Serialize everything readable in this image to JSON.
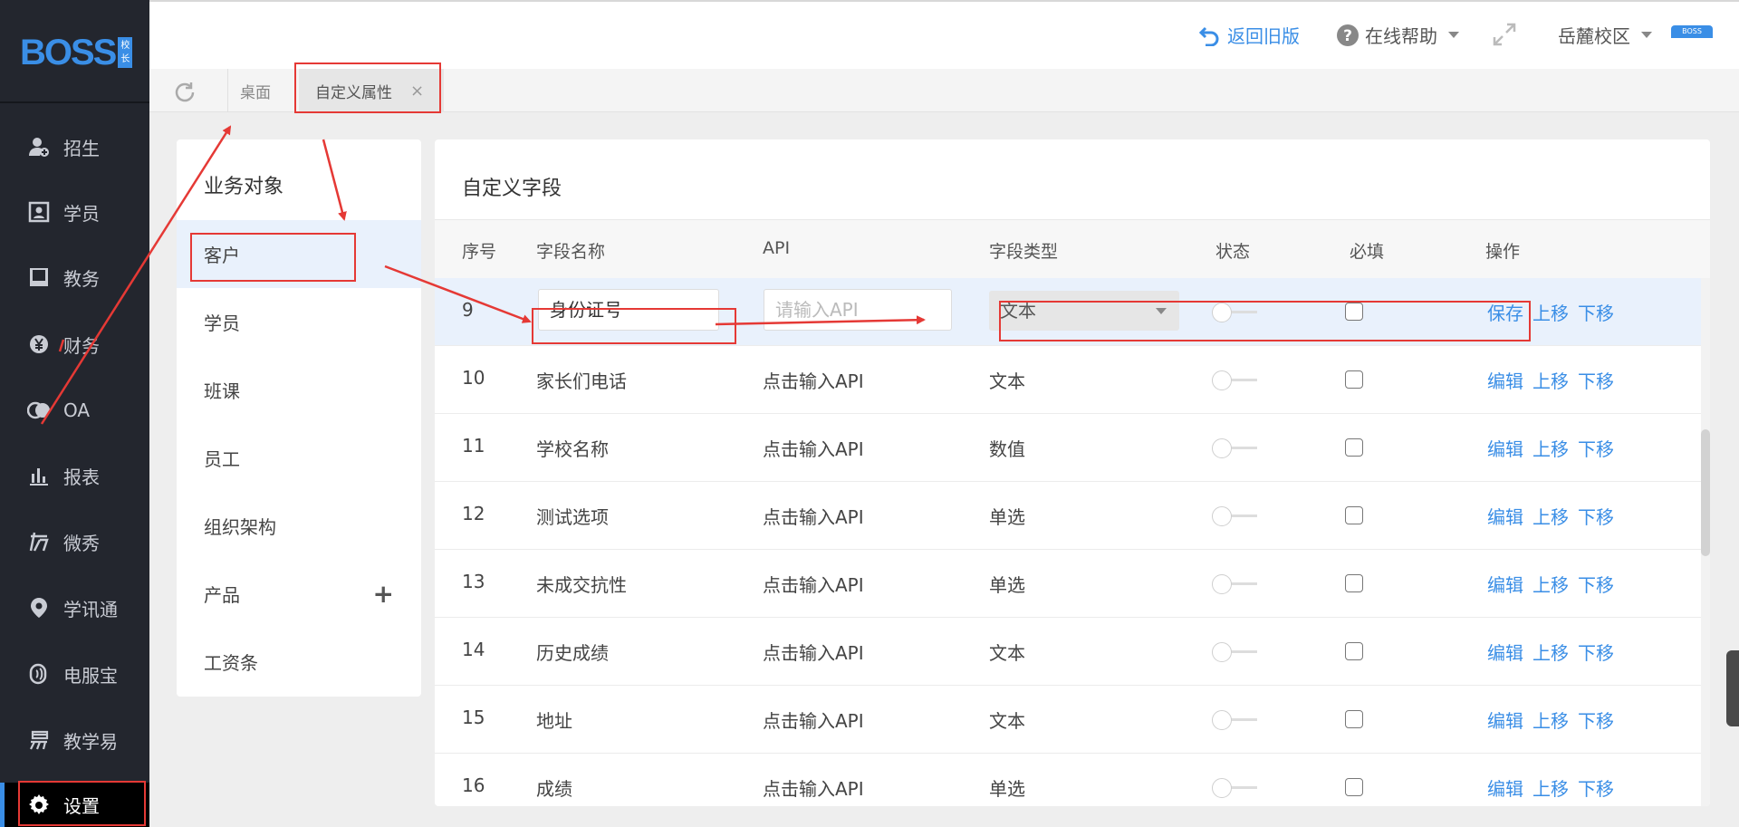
{
  "app": {
    "logo_text": "BOSS",
    "logo_badge": "校长"
  },
  "sidebar": {
    "items": [
      {
        "label": "招生",
        "icon": "user-add-icon"
      },
      {
        "label": "学员",
        "icon": "id-card-icon"
      },
      {
        "label": "教务",
        "icon": "book-icon"
      },
      {
        "label": "财务",
        "icon": "yen-coin-icon"
      },
      {
        "label": "OA",
        "icon": "oa-circles-icon"
      },
      {
        "label": "报表",
        "icon": "bar-chart-icon"
      },
      {
        "label": "微秀",
        "icon": "weixiu-icon"
      },
      {
        "label": "学讯通",
        "icon": "location-pin-icon"
      },
      {
        "label": "电服宝",
        "icon": "phone-signal-icon"
      },
      {
        "label": "教学易",
        "icon": "edu-logo-icon"
      },
      {
        "label": "设置",
        "icon": "gear-icon",
        "active": true
      }
    ]
  },
  "header": {
    "back_label": "返回旧版",
    "help_label": "在线帮助",
    "campus_label": "岳麓校区",
    "avatar_label": "BOSS"
  },
  "tabs": {
    "desk_label": "桌面",
    "custom_label": "自定义属性",
    "close_glyph": "×"
  },
  "objects": {
    "title": "业务对象",
    "items": [
      "客户",
      "学员",
      "班课",
      "员工",
      "组织架构",
      "产品",
      "工资条"
    ],
    "active_index": 0,
    "plus_glyph": "+"
  },
  "fields": {
    "title": "自定义字段",
    "columns": [
      "序号",
      "字段名称",
      "API",
      "字段类型",
      "状态",
      "必填",
      "操作"
    ],
    "editing_row": {
      "no": "9",
      "name_value": "身份证号",
      "api_placeholder": "请输入API",
      "type_value": "文本",
      "ops": [
        "保存",
        "上移",
        "下移"
      ]
    },
    "rows": [
      {
        "no": "10",
        "name": "家长们电话",
        "api": "点击输入API",
        "type": "文本",
        "ops": [
          "编辑",
          "上移",
          "下移"
        ]
      },
      {
        "no": "11",
        "name": "学校名称",
        "api": "点击输入API",
        "type": "数值",
        "ops": [
          "编辑",
          "上移",
          "下移"
        ]
      },
      {
        "no": "12",
        "name": "测试选项",
        "api": "点击输入API",
        "type": "单选",
        "ops": [
          "编辑",
          "上移",
          "下移"
        ]
      },
      {
        "no": "13",
        "name": "未成交抗性",
        "api": "点击输入API",
        "type": "单选",
        "ops": [
          "编辑",
          "上移",
          "下移"
        ]
      },
      {
        "no": "14",
        "name": "历史成绩",
        "api": "点击输入API",
        "type": "文本",
        "ops": [
          "编辑",
          "上移",
          "下移"
        ]
      },
      {
        "no": "15",
        "name": "地址",
        "api": "点击输入API",
        "type": "文本",
        "ops": [
          "编辑",
          "上移",
          "下移"
        ]
      },
      {
        "no": "16",
        "name": "成绩",
        "api": "点击输入API",
        "type": "单选",
        "ops": [
          "编辑",
          "上移",
          "下移"
        ]
      }
    ]
  },
  "colors": {
    "accent": "#3a8ee6",
    "annotation": "#e53935",
    "sidebar_bg": "#23262e"
  }
}
